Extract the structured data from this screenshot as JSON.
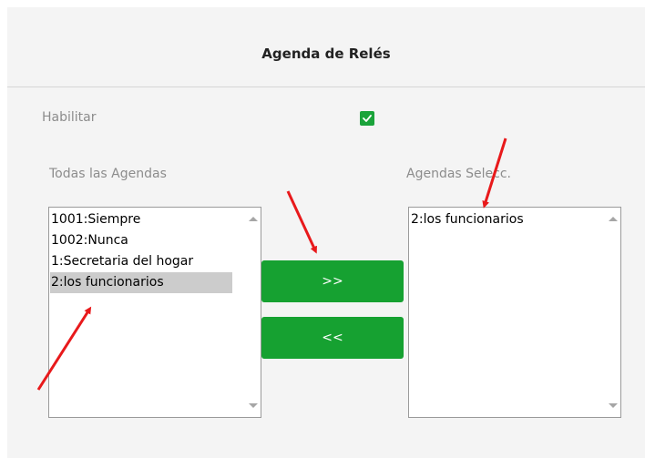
{
  "header": {
    "title": "Agenda de Relés"
  },
  "form": {
    "enable_label": "Habilitar",
    "enable_checked": true,
    "all_schedules_label": "Todas las Agendas",
    "selected_schedules_label": "Agendas Selecc."
  },
  "all_schedules": [
    "1001:Siempre",
    "1002:Nunca",
    "1:Secretaria del hogar",
    "2:los funcionarios"
  ],
  "all_schedules_selected_index": 3,
  "selected_schedules": [
    "2:los funcionarios"
  ],
  "buttons": {
    "add_label": ">>",
    "remove_label": "<<"
  },
  "colors": {
    "accent": "#16a131",
    "annotation_arrow": "#e8191b",
    "panel_bg": "#f4f4f4"
  }
}
